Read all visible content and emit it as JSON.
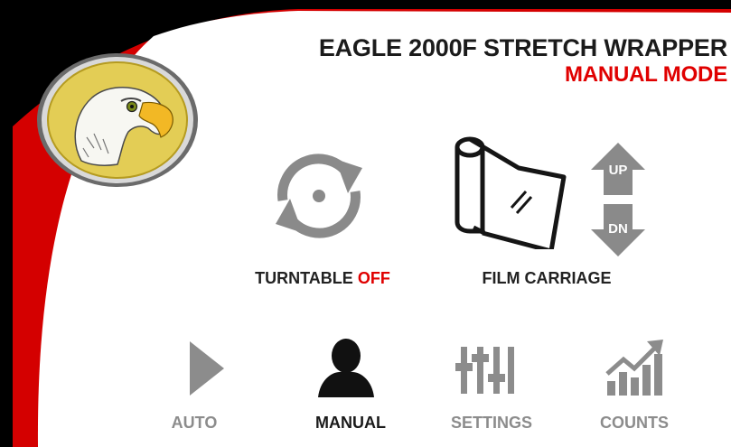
{
  "header": {
    "title": "EAGLE 2000F STRETCH WRAPPER",
    "mode": "MANUAL MODE"
  },
  "colors": {
    "accent_red": "#d40000",
    "status_red": "#e00000",
    "logo_gold": "#e3cd55",
    "inactive_gray": "#8c8c8c",
    "active_black": "#1a1a1a"
  },
  "controls": {
    "turntable": {
      "label": "TURNTABLE",
      "status": "OFF",
      "icon": "rotate-icon"
    },
    "film_carriage": {
      "label": "FILM CARRIAGE",
      "icon": "film-roll-icon"
    },
    "up_button": {
      "label": "UP",
      "icon": "arrow-up-icon"
    },
    "down_button": {
      "label": "DN",
      "icon": "arrow-down-icon"
    }
  },
  "nav": [
    {
      "label": "AUTO",
      "icon": "play-icon",
      "active": false
    },
    {
      "label": "MANUAL",
      "icon": "user-icon",
      "active": true
    },
    {
      "label": "SETTINGS",
      "icon": "sliders-icon",
      "active": false
    },
    {
      "label": "COUNTS",
      "icon": "bar-chart-icon",
      "active": false
    }
  ]
}
